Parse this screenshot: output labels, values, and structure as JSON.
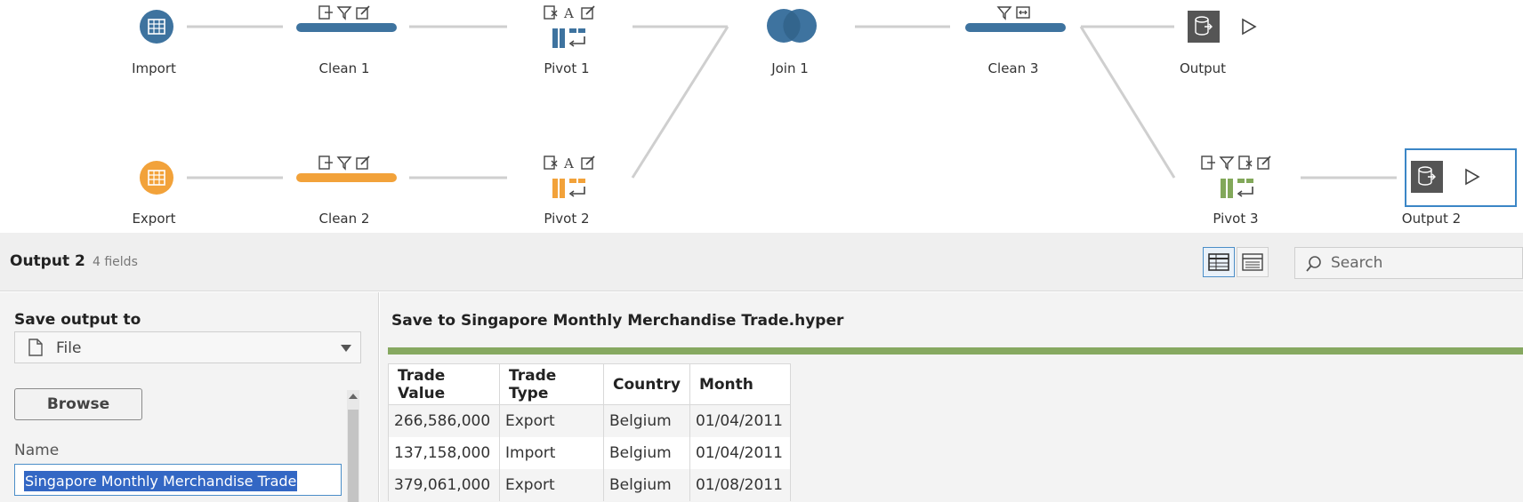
{
  "flow": {
    "nodes": [
      {
        "id": "import",
        "label": "Import"
      },
      {
        "id": "clean1",
        "label": "Clean 1"
      },
      {
        "id": "pivot1",
        "label": "Pivot 1"
      },
      {
        "id": "join1",
        "label": "Join 1"
      },
      {
        "id": "clean3",
        "label": "Clean 3"
      },
      {
        "id": "output1",
        "label": "Output"
      },
      {
        "id": "export",
        "label": "Export"
      },
      {
        "id": "clean2",
        "label": "Clean 2"
      },
      {
        "id": "pivot2",
        "label": "Pivot 2"
      },
      {
        "id": "pivot3",
        "label": "Pivot 3"
      },
      {
        "id": "output2",
        "label": "Output 2"
      }
    ],
    "colors": {
      "blue": "#3e739f",
      "orange": "#f2a23a",
      "green": "#82a85a",
      "output": "#555555",
      "selected": "#3b86c6"
    }
  },
  "panel": {
    "title": "Output 2",
    "fields": "4 fields",
    "search_placeholder": "Search"
  },
  "settings": {
    "save_output_label": "Save output to",
    "save_option": "File",
    "browse_label": "Browse",
    "name_label": "Name",
    "name_value": "Singapore Monthly Merchandise Trade"
  },
  "preview": {
    "title": "Save to Singapore Monthly Merchandise Trade.hyper",
    "columns": [
      "Trade Value",
      "Trade Type",
      "Country",
      "Month"
    ],
    "rows": [
      [
        "266,586,000",
        "Export",
        "Belgium",
        "01/04/2011"
      ],
      [
        "137,158,000",
        "Import",
        "Belgium",
        "01/04/2011"
      ],
      [
        "379,061,000",
        "Export",
        "Belgium",
        "01/08/2011"
      ]
    ],
    "progress_percent": 100
  }
}
